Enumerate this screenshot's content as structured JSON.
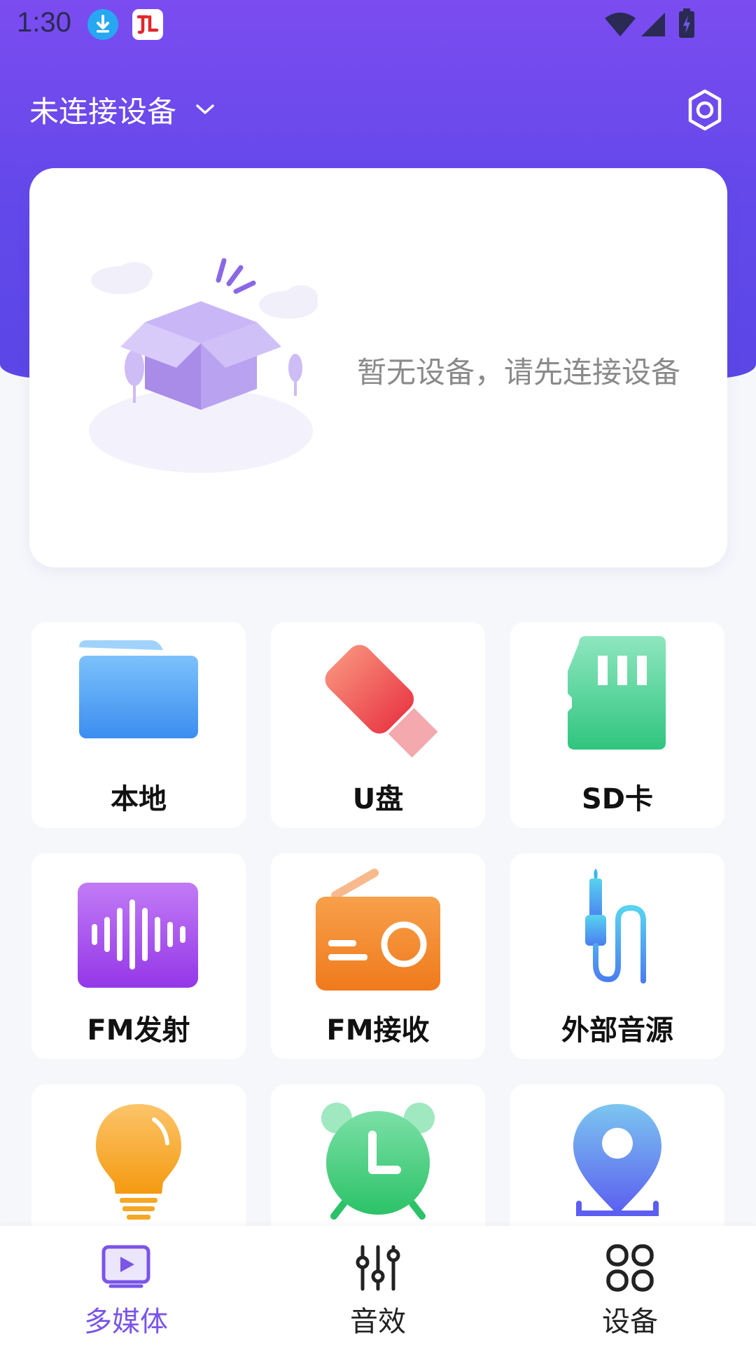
{
  "status_bar": {
    "time": "1:30"
  },
  "header": {
    "device_label": "未连接设备"
  },
  "empty_state": {
    "message": "暂无设备，请先连接设备"
  },
  "grid": {
    "items": [
      {
        "label": "本地",
        "icon": "folder-icon",
        "color": "#4a9cf0"
      },
      {
        "label": "U盘",
        "icon": "usb-drive-icon",
        "color": "#ef5757"
      },
      {
        "label": "SD卡",
        "icon": "sd-card-icon",
        "color": "#38c985"
      },
      {
        "label": "FM发射",
        "icon": "sound-wave-icon",
        "color": "#a45cf0"
      },
      {
        "label": "FM接收",
        "icon": "radio-icon",
        "color": "#f5862e"
      },
      {
        "label": "外部音源",
        "icon": "audio-cable-icon",
        "color": "#4aa8ec"
      },
      {
        "label": "",
        "icon": "light-bulb-icon",
        "color": "#f7a21a"
      },
      {
        "label": "",
        "icon": "alarm-clock-icon",
        "color": "#3ecf7b"
      },
      {
        "label": "",
        "icon": "location-pin-icon",
        "color": "#6578f2"
      }
    ]
  },
  "bottom_nav": {
    "items": [
      {
        "label": "多媒体",
        "icon": "media-play-icon",
        "active": true
      },
      {
        "label": "音效",
        "icon": "equalizer-icon",
        "active": false
      },
      {
        "label": "设备",
        "icon": "device-grid-icon",
        "active": false
      }
    ],
    "active_color": "#7a55e8",
    "inactive_color": "#222222"
  }
}
